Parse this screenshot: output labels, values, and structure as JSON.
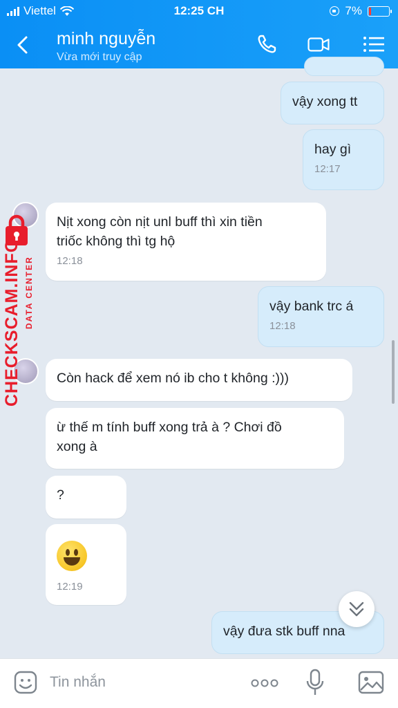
{
  "status_bar": {
    "carrier": "Viettel",
    "time": "12:25 CH",
    "battery": "7%"
  },
  "header": {
    "contact_name": "minh nguyễn",
    "presence": "Vừa mới truy cập"
  },
  "messages": [
    {
      "text": "vậy xong tt",
      "time": ""
    },
    {
      "text": "hay gì",
      "time": "12:17"
    },
    {
      "text": "Nịt xong còn nịt unl buff thì xin tiền triốc không thì tg hộ",
      "line1": "Nịt xong còn nịt unl buff thì xin tiền",
      "line2": "triốc không thì tg hộ",
      "time": "12:18"
    },
    {
      "text": "vậy bank trc á",
      "time": "12:18"
    },
    {
      "text": "Còn hack để xem nó ib cho t không :)))",
      "time": ""
    },
    {
      "text": "ừ thế m tính buff xong trả à ? Chơi đồ xong à",
      "line1": "ừ thế m tính buff xong trả à ? Chơi đồ",
      "line2": "xong à",
      "time": ""
    },
    {
      "text": "?",
      "time": ""
    },
    {
      "text": "",
      "emoji": "grinning-face",
      "time": "12:19"
    },
    {
      "text": "vậy đưa stk buff nna",
      "time": ""
    }
  ],
  "watermark": {
    "brand": "CHECKSCAM.INFO",
    "tagline": "DATA CENTER"
  },
  "composer": {
    "placeholder": "Tin nhắn",
    "more_label": "ooo"
  },
  "colors": {
    "header_blue": "#0a8ff5",
    "outgoing_bubble": "#d6ecfb",
    "incoming_bubble": "#ffffff",
    "watermark_red": "#e81d2c"
  }
}
